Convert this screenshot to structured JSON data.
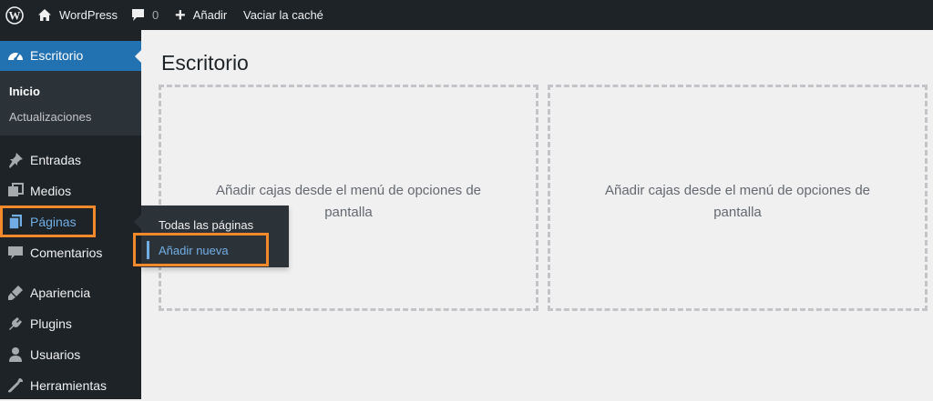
{
  "admin_bar": {
    "site_name": "WordPress",
    "comments_count": "0",
    "new_label": "Añadir",
    "cache_label": "Vaciar la caché"
  },
  "sidebar": {
    "dashboard_label": "Escritorio",
    "submenu": [
      "Inicio",
      "Actualizaciones"
    ],
    "items": [
      {
        "label": "Entradas",
        "icon": "pin-icon"
      },
      {
        "label": "Medios",
        "icon": "media-icon"
      },
      {
        "label": "Páginas",
        "icon": "pages-icon"
      },
      {
        "label": "Comentarios",
        "icon": "comment-icon"
      },
      {
        "label": "Apariencia",
        "icon": "appearance-icon"
      },
      {
        "label": "Plugins",
        "icon": "plugin-icon"
      },
      {
        "label": "Usuarios",
        "icon": "users-icon"
      },
      {
        "label": "Herramientas",
        "icon": "tools-icon"
      }
    ]
  },
  "flyout": {
    "items": [
      "Todas las páginas",
      "Añadir nueva"
    ]
  },
  "main": {
    "title": "Escritorio",
    "boxes": [
      "Añadir cajas desde el menú de opciones de pantalla",
      "Añadir cajas desde el menú de opciones de pantalla"
    ]
  },
  "colors": {
    "admin_bar_bg": "#1d2327",
    "sidebar_bg": "#1d2327",
    "submenu_bg": "#2c3338",
    "accent": "#2271b1",
    "highlight": "#f28a2c",
    "current_link": "#72aee6"
  }
}
